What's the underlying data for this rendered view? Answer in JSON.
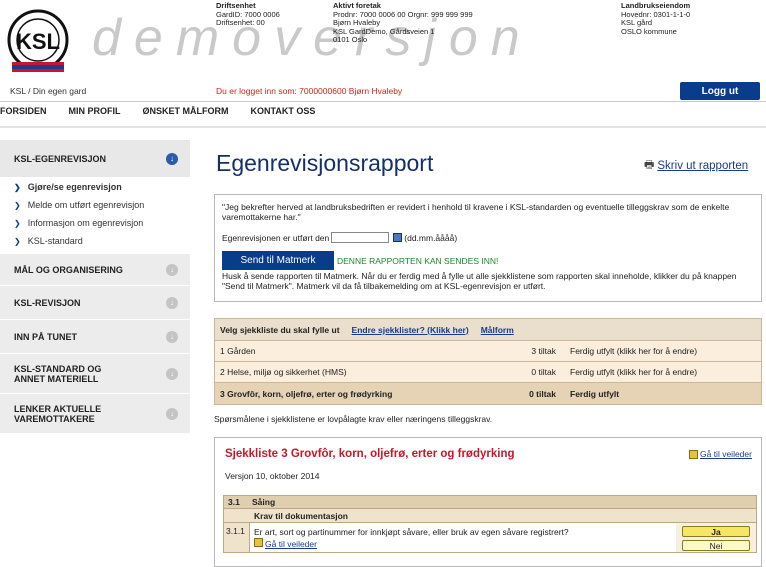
{
  "header": {
    "logo_text": "KSL",
    "logo_ring_top": "KVALITETSSYSTEM",
    "logo_ring_bottom": "LANDBRUKET",
    "watermark": "demoversjon",
    "driftsenhet": {
      "title": "Driftsenhet",
      "lines": [
        "GardID: 7000 0006",
        "Driftsenhet: 00"
      ]
    },
    "foretak": {
      "title": "Aktivt foretak",
      "lines": [
        "Prodnr: 7000 0006 00 Orgnr: 999 999 999",
        "Bjørn Hvaleby",
        "KSL GardDemo, Gårdsveien 1",
        "0101 Oslo"
      ]
    },
    "eiendom": {
      "title": "Landbrukseiendom",
      "lines": [
        "Hovednr: 0301-1-1-0",
        "KSL gård",
        "OSLO kommune"
      ]
    },
    "breadcrumb": "KSL / Din egen gard",
    "logged_in": "Du er logget inn som: 7000000600 Bjørn Hvaleby",
    "logout": "Logg ut"
  },
  "nav": [
    "FORSIDEN",
    "MIN PROFIL",
    "ØNSKET MÅLFORM",
    "KONTAKT OSS"
  ],
  "sidebar": {
    "sections": [
      {
        "label": "KSL-EGENREVISJON",
        "open": true
      },
      {
        "label": "MÅL OG ORGANISERING"
      },
      {
        "label": "KSL-REVISJON"
      },
      {
        "label": "INN PÅ TUNET"
      },
      {
        "label": "KSL-STANDARD OG ANNET MATERIELL"
      },
      {
        "label": "LENKER AKTUELLE VAREMOTTAKERE"
      }
    ],
    "items": [
      "Gjøre/se egenrevisjon",
      "Melde om utført egenrevisjon",
      "Informasjon om egenrevisjon",
      "KSL-standard"
    ]
  },
  "main": {
    "title": "Egenrevisjonsrapport",
    "print": "Skriv ut rapporten",
    "confirm_text": "\"Jeg bekrefter herved at landbruksbedriften er revidert i henhold til kravene i KSL-standarden og eventuelle tilleggskrav som de enkelte varemottakerne har.\"",
    "date_label": "Egenrevisjonen er utført den",
    "date_value": "",
    "date_format": "(dd.mm.åååå)",
    "send_button": "Send til Matmerk",
    "send_status": "DENNE RAPPORTEN KAN SENDES INN!",
    "hint": "Husk å sende rapporten til Matmerk. Når du er ferdig med å fylle ut alle sjekklistene som rapporten skal inneholde, klikker du på knappen \"Send til Matmerk\". Matmerk vil da få tilbakemelding om at KSL-egenrevisjon er utført.",
    "table": {
      "head_label": "Velg sjekkliste du skal fylle ut",
      "head_link1": "Endre sjekklister? (Klikk her)",
      "head_link2": "Målform",
      "rows": [
        {
          "name": "1 Gården",
          "count": "3 tiltak",
          "status": "Ferdig utfylt (klikk her for å endre)"
        },
        {
          "name": "2 Helse, miljø og sikkerhet (HMS)",
          "count": "0 tiltak",
          "status": "Ferdig utfylt (klikk her for å endre)"
        },
        {
          "name": "3 Grovfôr, korn, oljefrø, erter og frødyrking",
          "count": "0 tiltak",
          "status": "Ferdig utfylt"
        }
      ]
    },
    "note": "Spørsmålene i sjekklistene er lovpålagte krav eller næringens tilleggskrav.",
    "checklist": {
      "title": "Sjekkliste 3 Grovfôr, korn, oljefrø, erter og frødyrking",
      "guide_link": "Gå til veileder",
      "version": "Versjon 10, oktober 2014",
      "section_num": "3.1",
      "section_label": "Såing",
      "subheader": "Krav til dokumentasjon",
      "q_num": "3.1.1",
      "q_text": "Er art, sort og partinummer for innkjøpt såvare, eller bruk av egen såvare registrert?",
      "q_link": "Gå til veileder",
      "yes": "Ja",
      "no": "Nei"
    }
  }
}
